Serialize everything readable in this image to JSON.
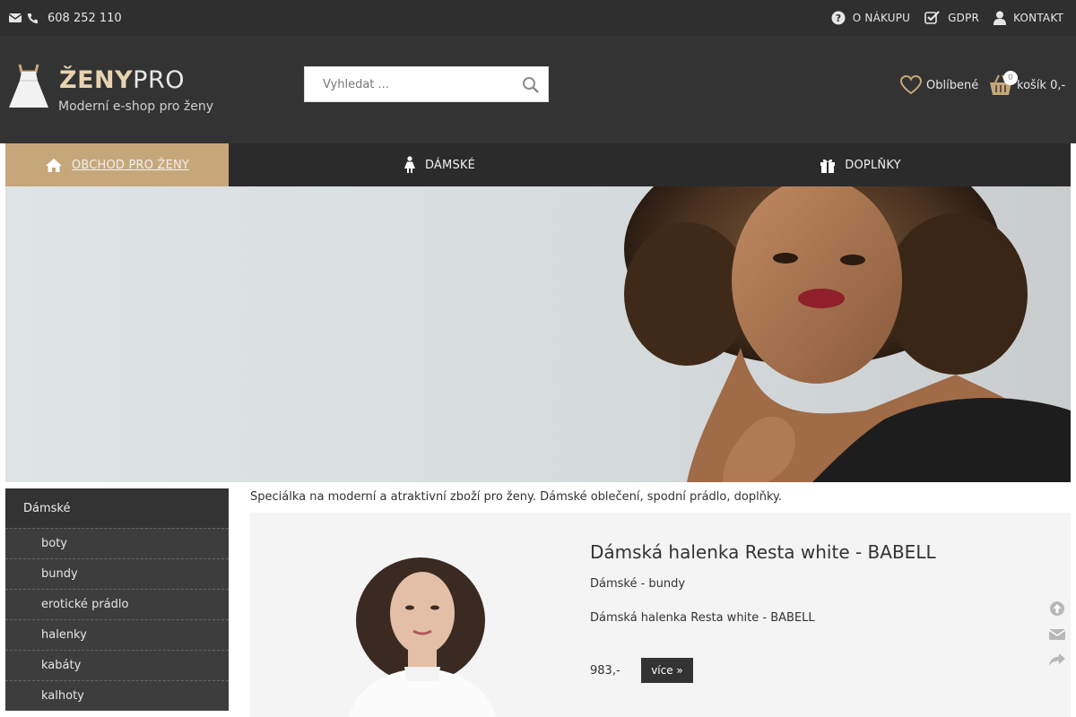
{
  "topbar": {
    "phone": "608 252 110",
    "links": [
      "O NÁKUPU",
      "GDPR",
      "KONTAKT"
    ]
  },
  "header": {
    "logo_bold": "ŽENY",
    "logo_light": "PRO",
    "logo_tagline": "Moderní e-shop pro ženy",
    "search_placeholder": "Vyhledat ...",
    "favorites_label": "Oblíbené",
    "cart_label": "košík 0,-",
    "cart_count": "0"
  },
  "nav": {
    "tabs": [
      "OBCHOD PRO ŽENY",
      "DÁMSKÉ",
      "DOPLŇKY"
    ]
  },
  "sidebar": {
    "title": "Dámské",
    "items": [
      "boty",
      "bundy",
      "erotické prádlo",
      "halenky",
      "kabáty",
      "kalhoty"
    ]
  },
  "main": {
    "intro": "Speciálka na moderní a atraktivní zboží pro ženy. Dámské oblečení, spodní prádlo, doplňky.",
    "product": {
      "title": "Dámská halenka Resta white - BABELL",
      "category": "Dámské - bundy",
      "description": "Dámská halenka Resta white - BABELL",
      "price": "983,-",
      "more_label": "více »"
    }
  },
  "colors": {
    "accent": "#c6a77a",
    "dark": "#333333",
    "topbar": "#2f2f2f"
  }
}
